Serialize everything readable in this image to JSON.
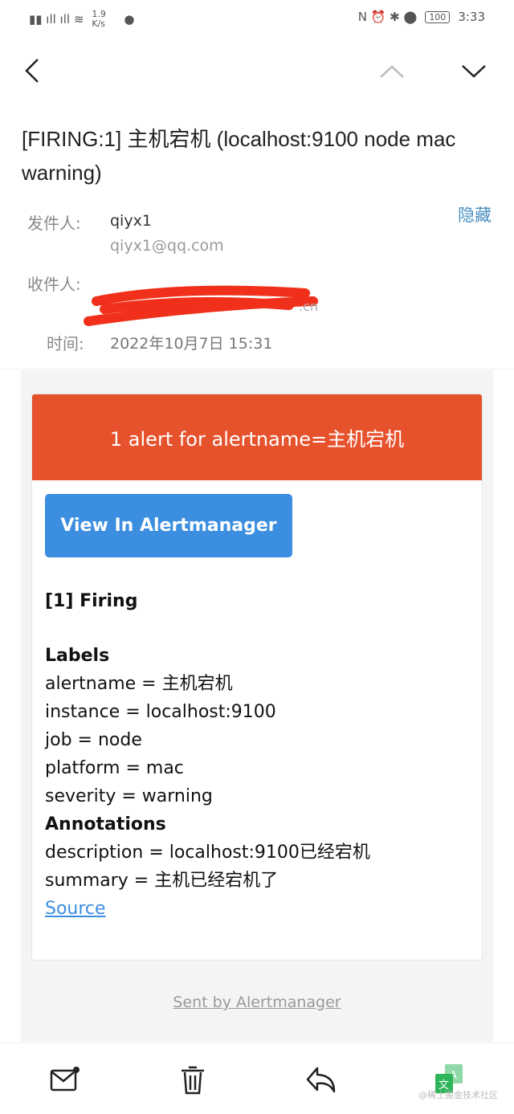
{
  "status_bar": {
    "speed": "1.9 K/s",
    "battery": "100",
    "time": "3:33",
    "left_icons": [
      "hd-icon",
      "sim-icon",
      "signal-4g-icon",
      "signal-2g-icon",
      "wifi-icon",
      "badge-100-icon",
      "qq-icon"
    ],
    "right_icons": [
      "nfc-icon",
      "alarm-icon",
      "bluetooth-icon",
      "location-icon",
      "battery-icon",
      "charging-icon"
    ]
  },
  "email": {
    "subject": "[FIRING:1] 主机宕机 (localhost:9100 node mac warning)",
    "hide_label": "隐藏",
    "from_label": "发件人:",
    "from_name": "qiyx1",
    "from_email": "qiyx1@qq.com",
    "to_label": "收件人:",
    "to_suffix": ".cn",
    "time_label": "时间:",
    "time_value": "2022年10月7日 15:31"
  },
  "alert": {
    "banner": "1 alert for alertname=主机宕机",
    "button": "View In Alertmanager",
    "firing": "[1] Firing",
    "labels_title": "Labels",
    "labels": [
      "alertname = 主机宕机",
      "instance = localhost:9100",
      "job = node",
      "platform = mac",
      "severity = warning"
    ],
    "annotations_title": "Annotations",
    "annotations": [
      "description = localhost:9100已经宕机",
      "summary = 主机已经宕机了"
    ],
    "source": "Source",
    "banner_color": "#e6522c",
    "button_color": "#3b8ee0"
  },
  "footer": {
    "sent_by": "Sent by Alertmanager"
  },
  "watermark": "@稀土掘金技术社区"
}
